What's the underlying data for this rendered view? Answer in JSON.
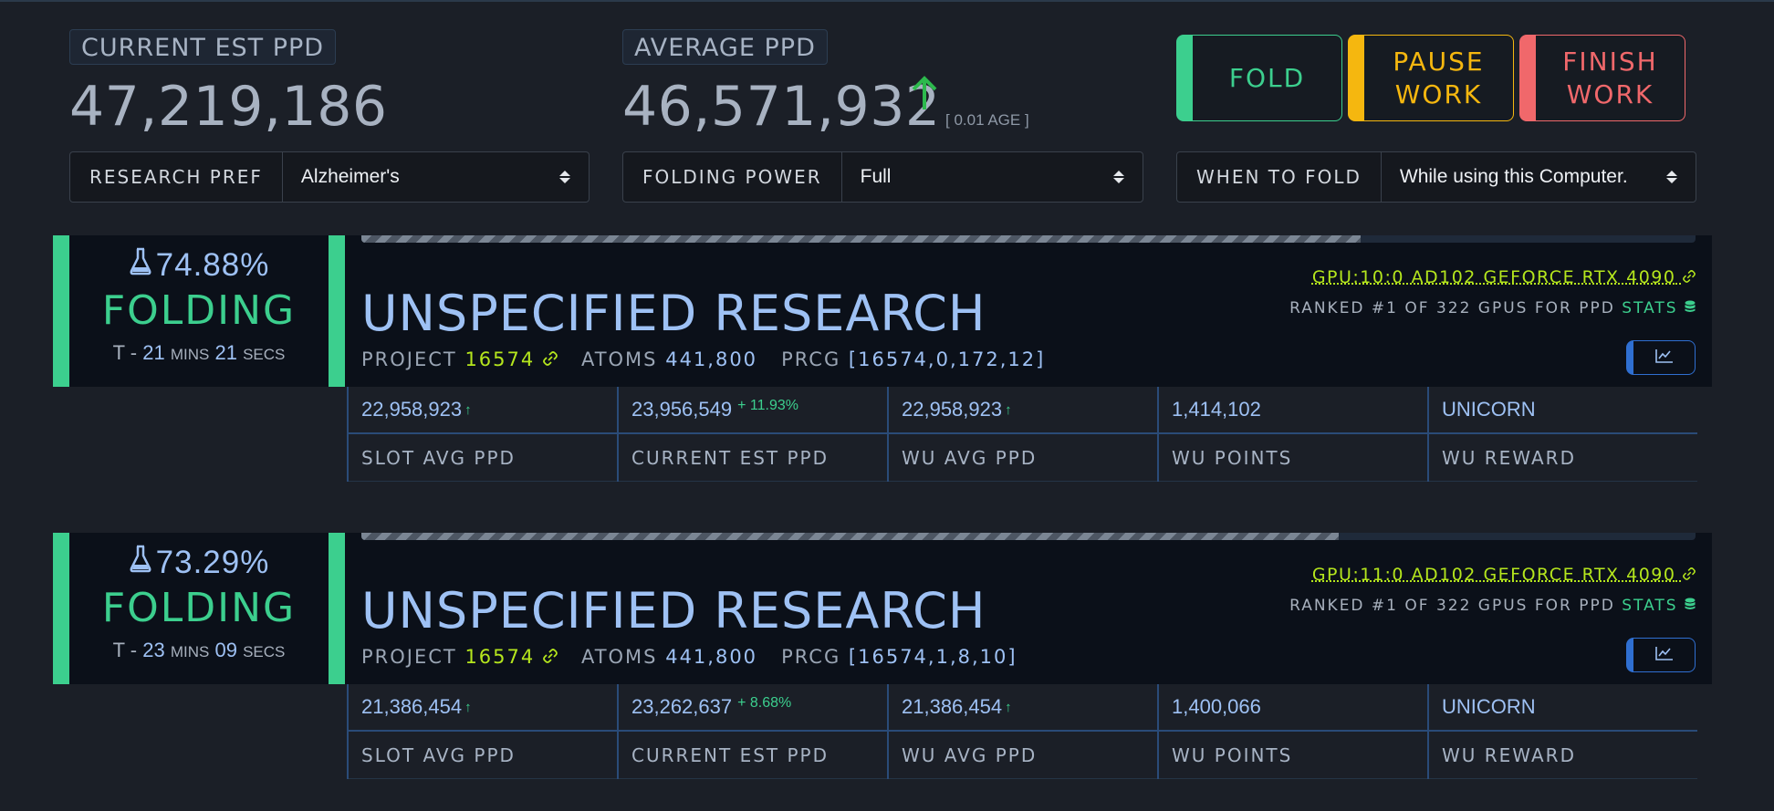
{
  "summary": {
    "current_est_ppd_label": "CURRENT EST PPD",
    "current_est_ppd_value": "47,219,186",
    "average_ppd_label": "AVERAGE PPD",
    "average_ppd_value": "46,571,932",
    "average_ppd_age": "[ 0.01 AGE ]"
  },
  "controls": {
    "research_pref_label": "RESEARCH PREF",
    "research_pref_value": "Alzheimer's",
    "folding_power_label": "FOLDING POWER",
    "folding_power_value": "Full",
    "when_to_fold_label": "WHEN TO FOLD",
    "when_to_fold_value": "While using this Computer."
  },
  "buttons": {
    "fold": "FOLD",
    "pause_line1": "PAUSE",
    "pause_line2": "WORK",
    "finish_line1": "FINISH",
    "finish_line2": "WORK"
  },
  "colors": {
    "accent_green": "#3ccf8e",
    "pause_yellow": "#f5b70f",
    "finish_red": "#f0686b",
    "link_lime": "#b5e61d",
    "value_blue": "#9ec1f4"
  },
  "slots": [
    {
      "progress_pct": 74.88,
      "progress_label": "74.88%",
      "status": "FOLDING",
      "eta_prefix": "T - ",
      "eta_mins": "21",
      "eta_mins_unit": "MINS",
      "eta_secs": "21",
      "eta_secs_unit": "SECS",
      "title": "UNSPECIFIED RESEARCH",
      "project_label": "PROJECT",
      "project_value": "16574",
      "atoms_label": "ATOMS",
      "atoms_value": "441,800",
      "prcg_label": "PRCG",
      "prcg_value": "[16574,0,172,12]",
      "gpu": "GPU:10:0 AD102 GEFORCE RTX 4090",
      "ranked_text": "RANKED #1 OF 322 GPUS FOR PPD",
      "stats_link": "STATS",
      "metrics": {
        "slot_avg_ppd": "22,958,923",
        "current_est_ppd": "23,956,549",
        "current_est_change": "+ 11.93%",
        "wu_avg_ppd": "22,958,923",
        "wu_points": "1,414,102",
        "wu_reward": "UNICORN"
      }
    },
    {
      "progress_pct": 73.29,
      "progress_label": "73.29%",
      "status": "FOLDING",
      "eta_prefix": "T - ",
      "eta_mins": "23",
      "eta_mins_unit": "MINS",
      "eta_secs": "09",
      "eta_secs_unit": "SECS",
      "title": "UNSPECIFIED RESEARCH",
      "project_label": "PROJECT",
      "project_value": "16574",
      "atoms_label": "ATOMS",
      "atoms_value": "441,800",
      "prcg_label": "PRCG",
      "prcg_value": "[16574,1,8,10]",
      "gpu": "GPU:11:0 AD102 GEFORCE RTX 4090",
      "ranked_text": "RANKED #1 OF 322 GPUS FOR PPD",
      "stats_link": "STATS",
      "metrics": {
        "slot_avg_ppd": "21,386,454",
        "current_est_ppd": "23,262,637",
        "current_est_change": "+ 8.68%",
        "wu_avg_ppd": "21,386,454",
        "wu_points": "1,400,066",
        "wu_reward": "UNICORN"
      }
    }
  ],
  "metric_labels": {
    "slot_avg_ppd": "SLOT AVG PPD",
    "current_est_ppd": "CURRENT EST PPD",
    "wu_avg_ppd": "WU AVG PPD",
    "wu_points": "WU POINTS",
    "wu_reward": "WU REWARD"
  },
  "icons": {
    "flask": "flask-icon",
    "link": "link-icon",
    "database": "database-icon",
    "chart": "line-chart-icon",
    "arrow_up": "arrow-up-icon",
    "caret": "select-caret-icon"
  }
}
